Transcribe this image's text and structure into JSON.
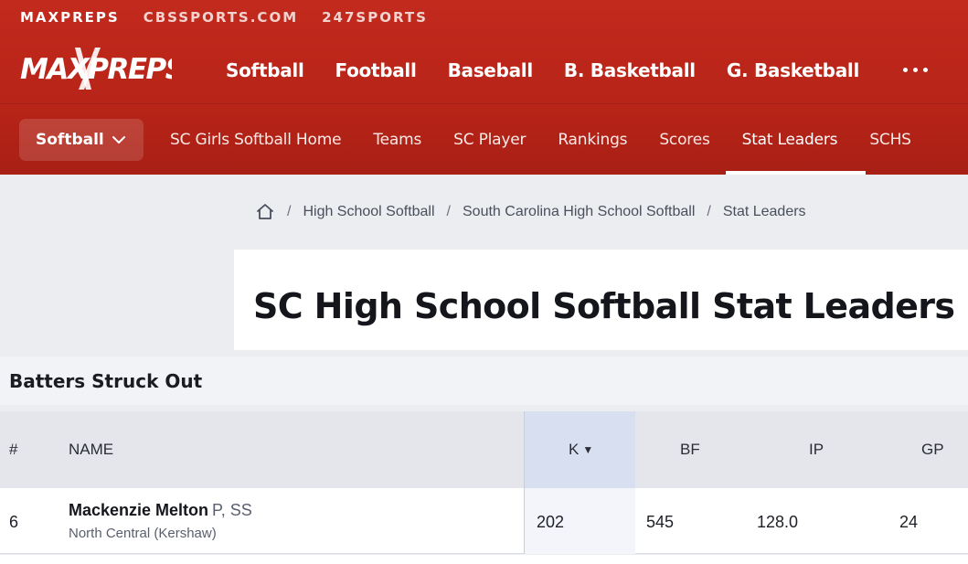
{
  "network": {
    "links": [
      "MAXPREPS",
      "CBSSPORTS.COM",
      "247SPORTS"
    ]
  },
  "logo": {
    "text": "MAXPREPS"
  },
  "main_nav": {
    "sports": [
      "Softball",
      "Football",
      "Baseball",
      "B. Basketball",
      "G. Basketball"
    ],
    "more_icon": "more-horizontal-icon"
  },
  "sub_nav": {
    "dropdown_label": "Softball",
    "links": [
      "SC Girls Softball Home",
      "Teams",
      "SC Player",
      "Rankings",
      "Scores",
      "Stat Leaders",
      "SCHS"
    ],
    "active": "Stat Leaders"
  },
  "breadcrumb": {
    "home_icon": "home-icon",
    "items": [
      "High School Softball",
      "South Carolina High School Softball",
      "Stat Leaders"
    ],
    "separator": "/"
  },
  "page": {
    "title": "SC High School Softball Stat Leaders"
  },
  "section": {
    "title": "Batters Struck Out"
  },
  "table": {
    "columns": {
      "rank": "#",
      "name": "NAME",
      "k": "K",
      "bf": "BF",
      "ip": "IP",
      "gp": "GP"
    },
    "sorted_column": "K",
    "sort_direction_icon": "sort-down-triangle-icon",
    "rows": [
      {
        "rank": "6",
        "name": "Mackenzie Melton",
        "positions": "P, SS",
        "school": "North Central (Kershaw)",
        "k": "202",
        "bf": "545",
        "ip": "128.0",
        "gp": "24"
      }
    ]
  },
  "colors": {
    "brand_red": "#b82418",
    "white": "#ffffff",
    "sorted_column_bg": "#d7dff0"
  }
}
